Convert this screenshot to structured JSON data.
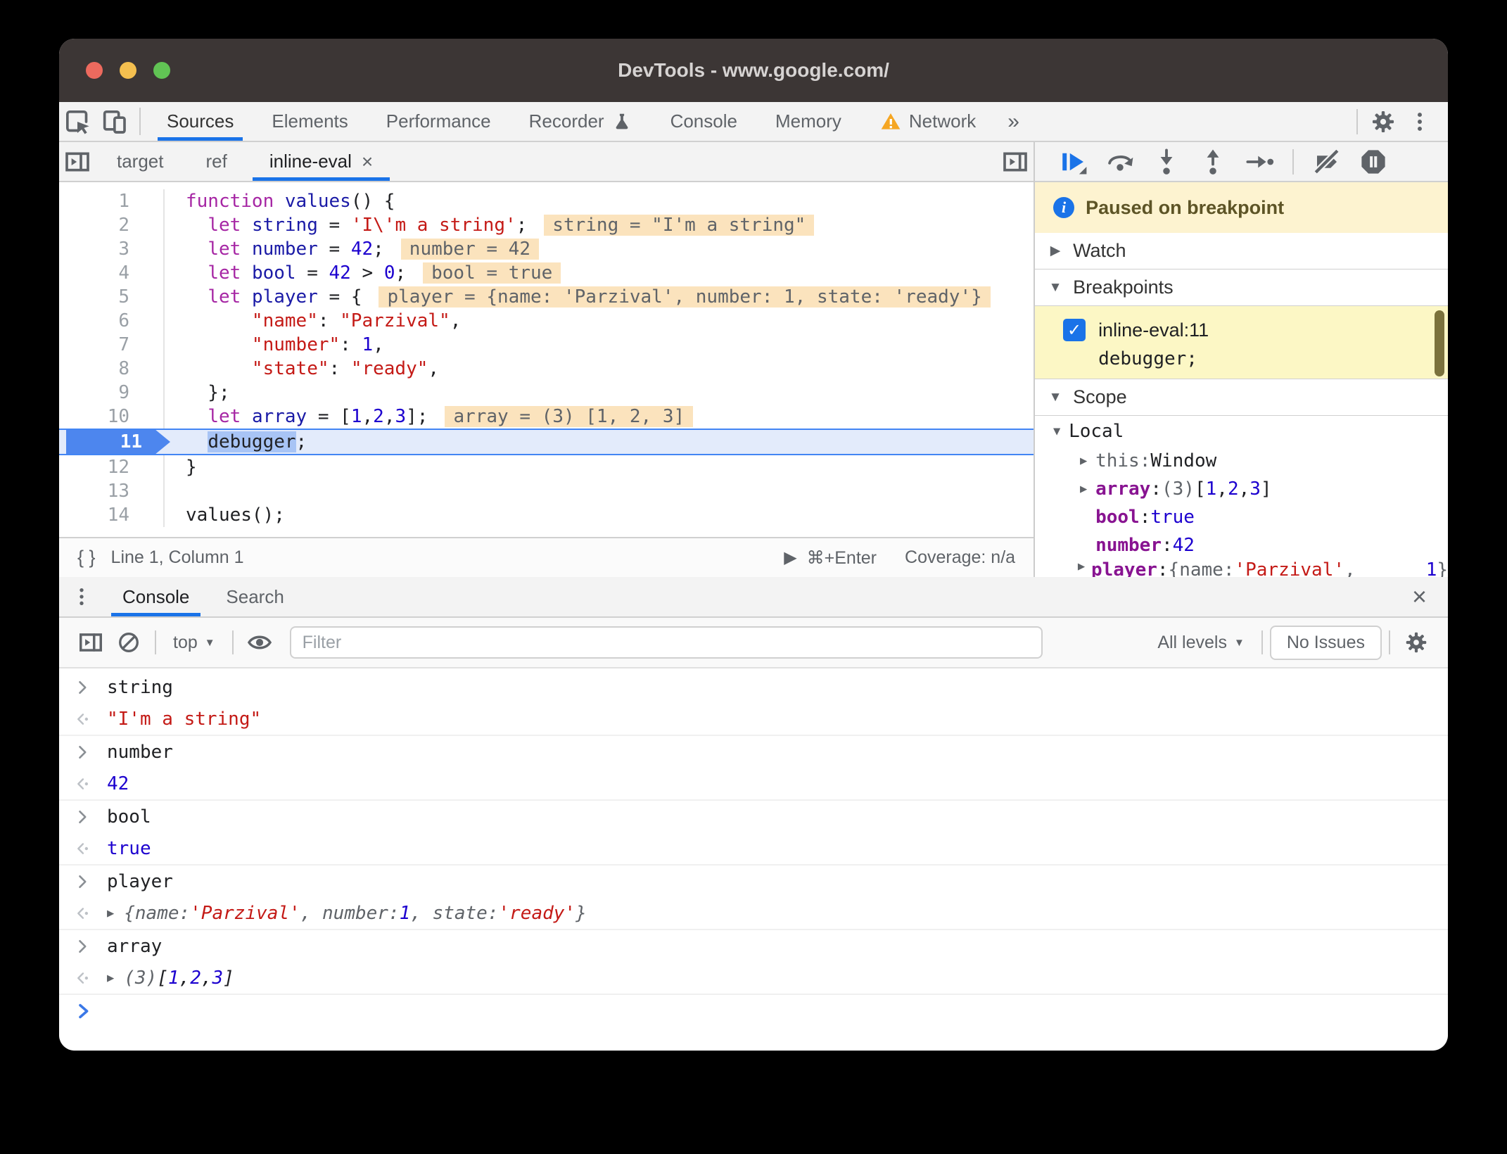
{
  "window": {
    "title": "DevTools - www.google.com/"
  },
  "colors": {
    "accent_blue": "#1a73e8",
    "titlebar_bg": "#3c3635",
    "toolbar_bg": "#f3f3f3",
    "paused_banner_bg": "#fdf3d0",
    "breakpoint_item_bg": "#fcf7c5",
    "inline_eval_bg": "#fbe3bd",
    "execution_line_bg": "#e3ebfb",
    "keyword": "#a626a4",
    "definition": "#1a1aa6",
    "string": "#c41a16",
    "number": "#1c00cf",
    "property": "#881391",
    "warning": "#f5a623"
  },
  "toolbar": {
    "icons": [
      "inspect-icon",
      "device-toolbar-icon",
      "gear-icon",
      "kebab-menu-icon"
    ],
    "tabs": [
      {
        "label": "Sources",
        "active": true
      },
      {
        "label": "Elements",
        "active": false
      },
      {
        "label": "Performance",
        "active": false
      },
      {
        "label": "Recorder",
        "active": false,
        "icon": "flask-icon"
      },
      {
        "label": "Console",
        "active": false
      },
      {
        "label": "Memory",
        "active": false
      },
      {
        "label": "Network",
        "active": false,
        "icon": "warning-icon"
      }
    ],
    "more_glyph": "»"
  },
  "sources": {
    "file_tabs": [
      {
        "label": "target",
        "active": false
      },
      {
        "label": "ref",
        "active": false
      },
      {
        "label": "inline-eval",
        "active": true,
        "close_glyph": "×"
      }
    ],
    "statusbar": {
      "brackets_glyph": "{ }",
      "position": "Line 1, Column 1",
      "play_glyph": "▶",
      "run_shortcut": "⌘+Enter",
      "coverage": "Coverage: n/a"
    }
  },
  "editor": {
    "lines": [
      {
        "n": "1",
        "segs": [
          {
            "t": "kw",
            "s": "function"
          },
          {
            "t": "plain",
            "s": " "
          },
          {
            "t": "def",
            "s": "values"
          },
          {
            "t": "plain",
            "s": "() {"
          }
        ]
      },
      {
        "n": "2",
        "segs": [
          {
            "t": "plain",
            "s": "  "
          },
          {
            "t": "kw",
            "s": "let"
          },
          {
            "t": "plain",
            "s": " "
          },
          {
            "t": "def",
            "s": "string"
          },
          {
            "t": "plain",
            "s": " = "
          },
          {
            "t": "str",
            "s": "'I\\'m a string'"
          },
          {
            "t": "plain",
            "s": ";"
          }
        ],
        "inline": "string = \"I'm a string\""
      },
      {
        "n": "3",
        "segs": [
          {
            "t": "plain",
            "s": "  "
          },
          {
            "t": "kw",
            "s": "let"
          },
          {
            "t": "plain",
            "s": " "
          },
          {
            "t": "def",
            "s": "number"
          },
          {
            "t": "plain",
            "s": " = "
          },
          {
            "t": "num",
            "s": "42"
          },
          {
            "t": "plain",
            "s": ";"
          }
        ],
        "inline": "number = 42"
      },
      {
        "n": "4",
        "segs": [
          {
            "t": "plain",
            "s": "  "
          },
          {
            "t": "kw",
            "s": "let"
          },
          {
            "t": "plain",
            "s": " "
          },
          {
            "t": "def",
            "s": "bool"
          },
          {
            "t": "plain",
            "s": " = "
          },
          {
            "t": "num",
            "s": "42"
          },
          {
            "t": "plain",
            "s": " > "
          },
          {
            "t": "num",
            "s": "0"
          },
          {
            "t": "plain",
            "s": ";"
          }
        ],
        "inline": "bool = true"
      },
      {
        "n": "5",
        "segs": [
          {
            "t": "plain",
            "s": "  "
          },
          {
            "t": "kw",
            "s": "let"
          },
          {
            "t": "plain",
            "s": " "
          },
          {
            "t": "def",
            "s": "player"
          },
          {
            "t": "plain",
            "s": " = {"
          }
        ],
        "inline": "player = {name: 'Parzival', number: 1, state: 'ready'}"
      },
      {
        "n": "6",
        "segs": [
          {
            "t": "plain",
            "s": "      "
          },
          {
            "t": "str",
            "s": "\"name\""
          },
          {
            "t": "plain",
            "s": ": "
          },
          {
            "t": "str",
            "s": "\"Parzival\""
          },
          {
            "t": "plain",
            "s": ","
          }
        ]
      },
      {
        "n": "7",
        "segs": [
          {
            "t": "plain",
            "s": "      "
          },
          {
            "t": "str",
            "s": "\"number\""
          },
          {
            "t": "plain",
            "s": ": "
          },
          {
            "t": "num",
            "s": "1"
          },
          {
            "t": "plain",
            "s": ","
          }
        ]
      },
      {
        "n": "8",
        "segs": [
          {
            "t": "plain",
            "s": "      "
          },
          {
            "t": "str",
            "s": "\"state\""
          },
          {
            "t": "plain",
            "s": ": "
          },
          {
            "t": "str",
            "s": "\"ready\""
          },
          {
            "t": "plain",
            "s": ","
          }
        ]
      },
      {
        "n": "9",
        "segs": [
          {
            "t": "plain",
            "s": "  };"
          }
        ]
      },
      {
        "n": "10",
        "segs": [
          {
            "t": "plain",
            "s": "  "
          },
          {
            "t": "kw",
            "s": "let"
          },
          {
            "t": "plain",
            "s": " "
          },
          {
            "t": "def",
            "s": "array"
          },
          {
            "t": "plain",
            "s": " = ["
          },
          {
            "t": "num",
            "s": "1"
          },
          {
            "t": "plain",
            "s": ","
          },
          {
            "t": "num",
            "s": "2"
          },
          {
            "t": "plain",
            "s": ","
          },
          {
            "t": "num",
            "s": "3"
          },
          {
            "t": "plain",
            "s": "];"
          }
        ],
        "inline": "array = (3) [1, 2, 3]"
      },
      {
        "n": "11",
        "current": true,
        "segs": [
          {
            "t": "plain",
            "s": "  "
          },
          {
            "t": "sel",
            "s": "debugger"
          },
          {
            "t": "plain",
            "s": ";"
          }
        ]
      },
      {
        "n": "12",
        "segs": [
          {
            "t": "plain",
            "s": "}"
          }
        ]
      },
      {
        "n": "13",
        "segs": []
      },
      {
        "n": "14",
        "segs": [
          {
            "t": "plain",
            "s": "values();"
          }
        ]
      }
    ]
  },
  "debugger_pane": {
    "toolbar_icons": [
      "resume-icon",
      "step-over-icon",
      "step-into-icon",
      "step-out-icon",
      "step-icon",
      "deactivate-breakpoints-icon",
      "pause-on-exceptions-icon"
    ],
    "paused_banner": "Paused on breakpoint",
    "watch_title": "Watch",
    "watch_arrow": "▶",
    "breakpoints_title": "Breakpoints",
    "breakpoints_arrow": "▼",
    "breakpoint": {
      "checked_glyph": "✓",
      "file_line": "inline-eval:11",
      "code": "debugger;"
    },
    "scope_title": "Scope",
    "scope_arrow": "▼",
    "scope_rows": [
      {
        "level": 1,
        "arrow": "▼",
        "name": "Local",
        "cls": "plain"
      },
      {
        "level": 2,
        "arrow": "▶",
        "name": "this",
        "cls": "gray",
        "value": [
          {
            "t": "plain",
            "s": "Window"
          }
        ]
      },
      {
        "level": 2,
        "arrow": "▶",
        "name": "array",
        "cls": "prop",
        "value": [
          {
            "t": "gray",
            "s": "(3) "
          },
          {
            "t": "plain",
            "s": "["
          },
          {
            "t": "num",
            "s": "1"
          },
          {
            "t": "plain",
            "s": ", "
          },
          {
            "t": "num",
            "s": "2"
          },
          {
            "t": "plain",
            "s": ", "
          },
          {
            "t": "num",
            "s": "3"
          },
          {
            "t": "plain",
            "s": "]"
          }
        ]
      },
      {
        "level": 2,
        "arrow": "",
        "name": "bool",
        "cls": "prop",
        "value": [
          {
            "t": "num",
            "s": "true"
          }
        ]
      },
      {
        "level": 2,
        "arrow": "",
        "name": "number",
        "cls": "prop",
        "value": [
          {
            "t": "num",
            "s": "42"
          }
        ]
      },
      {
        "level": 2,
        "arrow": "▶",
        "name": "player",
        "cls": "prop",
        "clipped": true,
        "value": [
          {
            "t": "gray",
            "s": "{name: "
          },
          {
            "t": "str",
            "s": "'Parzival'"
          },
          {
            "t": "gray",
            "s": ", number: "
          },
          {
            "t": "num",
            "s": "1"
          },
          {
            "t": "gray",
            "s": "}"
          }
        ]
      }
    ]
  },
  "console": {
    "tabs": [
      {
        "label": "Console",
        "active": true
      },
      {
        "label": "Search",
        "active": false
      }
    ],
    "close_glyph": "×",
    "toolbar": {
      "icons": [
        "panel-toggle-icon",
        "clear-console-icon",
        "eye-icon",
        "gear-icon"
      ],
      "context": "top",
      "caret_glyph": "▼",
      "filter_placeholder": "Filter",
      "levels": "All levels",
      "issues": "No Issues"
    },
    "prompt_glyph": "›",
    "rows": [
      {
        "type": "input",
        "text": "string"
      },
      {
        "type": "result",
        "segs": [
          {
            "t": "str",
            "s": "\"I'm a string\""
          }
        ]
      },
      {
        "type": "input",
        "text": "number"
      },
      {
        "type": "result",
        "segs": [
          {
            "t": "num",
            "s": "42"
          }
        ]
      },
      {
        "type": "input",
        "text": "bool"
      },
      {
        "type": "result",
        "segs": [
          {
            "t": "num",
            "s": "true"
          }
        ]
      },
      {
        "type": "input",
        "text": "player"
      },
      {
        "type": "result",
        "italic": true,
        "expandable": true,
        "segs": [
          {
            "t": "gray",
            "s": "{name: "
          },
          {
            "t": "str",
            "s": "'Parzival'"
          },
          {
            "t": "gray",
            "s": ", number: "
          },
          {
            "t": "num",
            "s": "1"
          },
          {
            "t": "gray",
            "s": ", state: "
          },
          {
            "t": "str",
            "s": "'ready'"
          },
          {
            "t": "gray",
            "s": "}"
          }
        ]
      },
      {
        "type": "input",
        "text": "array"
      },
      {
        "type": "result",
        "italic": true,
        "expandable": true,
        "segs": [
          {
            "t": "gray",
            "s": "(3) "
          },
          {
            "t": "plain",
            "s": "["
          },
          {
            "t": "num",
            "s": "1"
          },
          {
            "t": "plain",
            "s": ", "
          },
          {
            "t": "num",
            "s": "2"
          },
          {
            "t": "plain",
            "s": ", "
          },
          {
            "t": "num",
            "s": "3"
          },
          {
            "t": "plain",
            "s": "]"
          }
        ]
      },
      {
        "type": "prompt"
      }
    ]
  }
}
